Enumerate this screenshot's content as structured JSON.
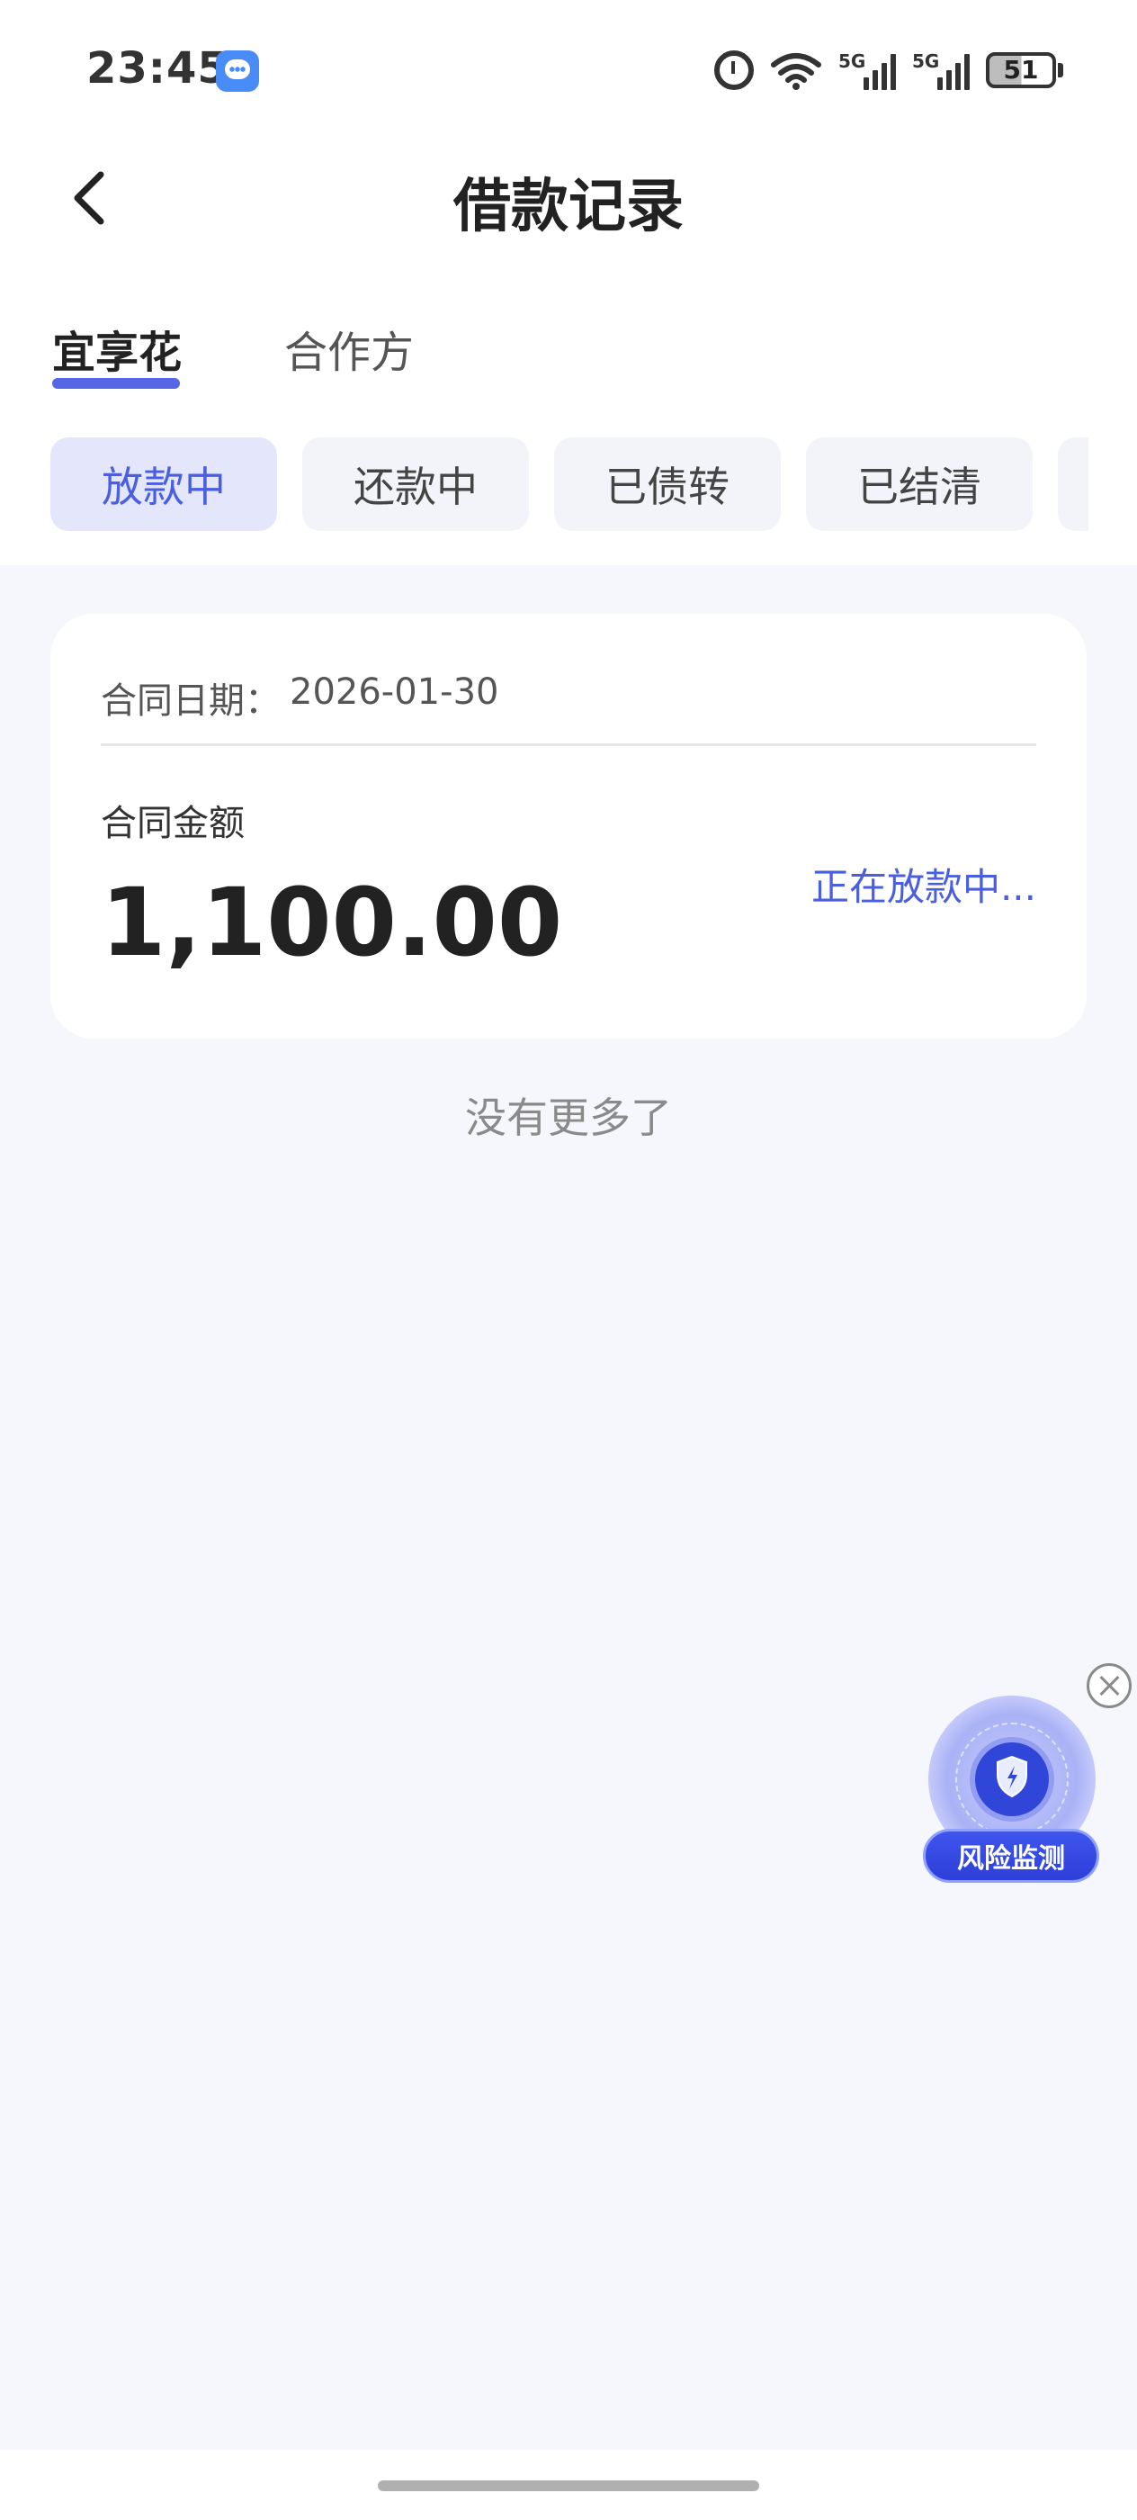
{
  "status_bar": {
    "time": "23:45",
    "network_left": "5G",
    "network_right": "5G",
    "battery": "51",
    "icons": [
      "message-icon",
      "alarm-icon",
      "wifi-icon",
      "signal-icon",
      "signal-icon",
      "battery-icon"
    ]
  },
  "nav": {
    "title": "借款记录",
    "back_icon": "chevron-left-icon"
  },
  "tabs": [
    {
      "label": "宜享花",
      "active": true
    },
    {
      "label": "合作方",
      "active": false
    }
  ],
  "filters": [
    {
      "label": "放款中",
      "active": true
    },
    {
      "label": "还款中",
      "active": false
    },
    {
      "label": "已债转",
      "active": false
    },
    {
      "label": "已结清",
      "active": false
    }
  ],
  "record": {
    "contract_date_label": "合同日期：",
    "contract_date": "2026-01-30",
    "amount_label": "合同金额",
    "amount": "1,100.00",
    "status": "正在放款中..."
  },
  "list_end_text": "没有更多了",
  "risk_widget": {
    "label": "风险监测",
    "icon": "shield-icon",
    "close_icon": "close-icon"
  },
  "colors": {
    "accent": "#4a5fe0",
    "page_bg": "#f6f7fc",
    "card_bg": "#ffffff"
  }
}
